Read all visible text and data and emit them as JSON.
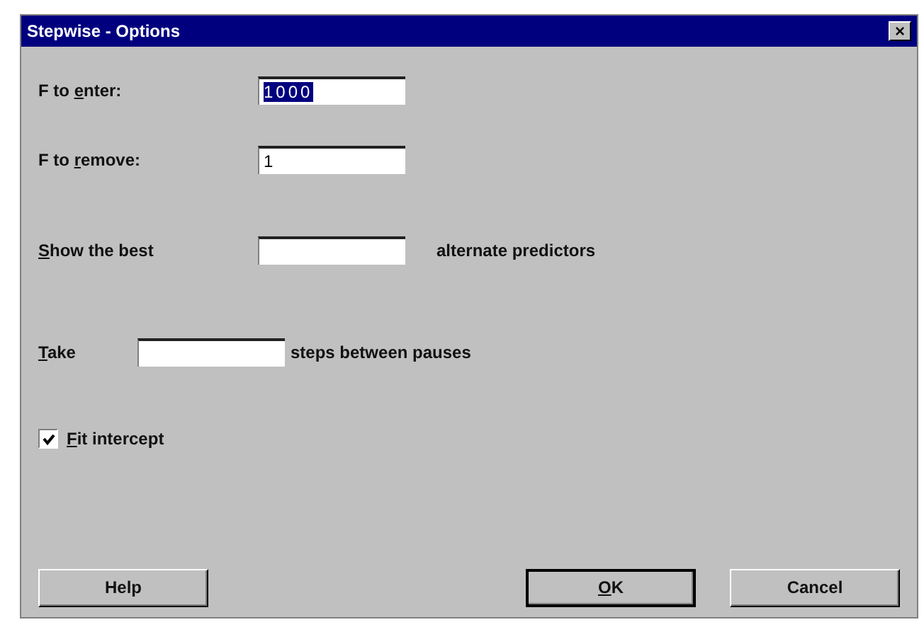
{
  "window": {
    "title": "Stepwise - Options",
    "close": "×"
  },
  "rows": [
    {
      "kind": "field",
      "label": {
        "pre": "F to ",
        "key": "e",
        "post": "nter:"
      },
      "value": "1000",
      "text_selected": true
    },
    {
      "kind": "field",
      "label": {
        "pre": "F to ",
        "key": "r",
        "post": "emove:"
      },
      "value": "1",
      "text_selected": false
    },
    {
      "kind": "field",
      "label": {
        "key": "S",
        "post": "how the best"
      },
      "suffix": "alternate predictors"
    },
    {
      "kind": "field",
      "label": {
        "key": "T",
        "post": "ake"
      },
      "suffix": "steps between pauses"
    },
    {
      "kind": "checkbox",
      "label": {
        "key": "F",
        "post": "it intercept"
      },
      "checked": true
    }
  ],
  "buttons": [
    {
      "label": {
        "pre": "Help"
      },
      "default": false
    },
    {
      "label": {
        "key": "O",
        "post": "K"
      },
      "default": true
    },
    {
      "label": {
        "pre": "Cancel"
      },
      "default": false
    }
  ]
}
